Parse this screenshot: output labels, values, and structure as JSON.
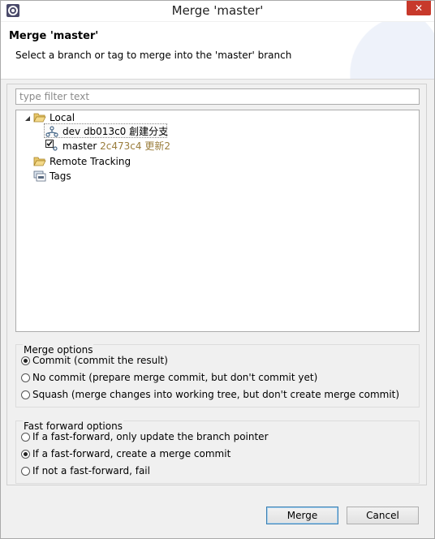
{
  "window": {
    "title": "Merge 'master'",
    "close_glyph": "✕"
  },
  "banner": {
    "title": "Merge 'master'",
    "subtitle": "Select a branch or tag to merge into the 'master' branch"
  },
  "filter": {
    "placeholder": "type filter text",
    "value": ""
  },
  "tree": {
    "local": {
      "label": "Local",
      "icon": "folder-open-icon",
      "expanded": true
    },
    "dev": {
      "name": "dev",
      "commit": "db013c0",
      "message": "創建分支",
      "icon": "branch-icon",
      "selected": true
    },
    "master": {
      "name": "master",
      "commit": "2c473c4",
      "message": "更新2",
      "icon": "checked-out-branch-icon"
    },
    "remote": {
      "label": "Remote Tracking",
      "icon": "folder-icon"
    },
    "tags": {
      "label": "Tags",
      "icon": "tags-icon"
    }
  },
  "merge_options": {
    "title": "Merge options",
    "options": [
      {
        "label": "Commit (commit the result)",
        "checked": true
      },
      {
        "label": "No commit (prepare merge commit, but don't commit yet)",
        "checked": false
      },
      {
        "label": "Squash (merge changes into working tree, but don't create merge commit)",
        "checked": false
      }
    ]
  },
  "ff_options": {
    "title": "Fast forward options",
    "options": [
      {
        "label": "If a fast-forward, only update the branch pointer",
        "checked": false
      },
      {
        "label": "If a fast-forward, create a merge commit",
        "checked": true
      },
      {
        "label": "If not a fast-forward, fail",
        "checked": false
      }
    ]
  },
  "buttons": {
    "merge": "Merge",
    "cancel": "Cancel"
  },
  "colors": {
    "close_button": "#c7392b",
    "commit_text": "#9a7d3c",
    "default_button_border": "#3c7fb1"
  }
}
